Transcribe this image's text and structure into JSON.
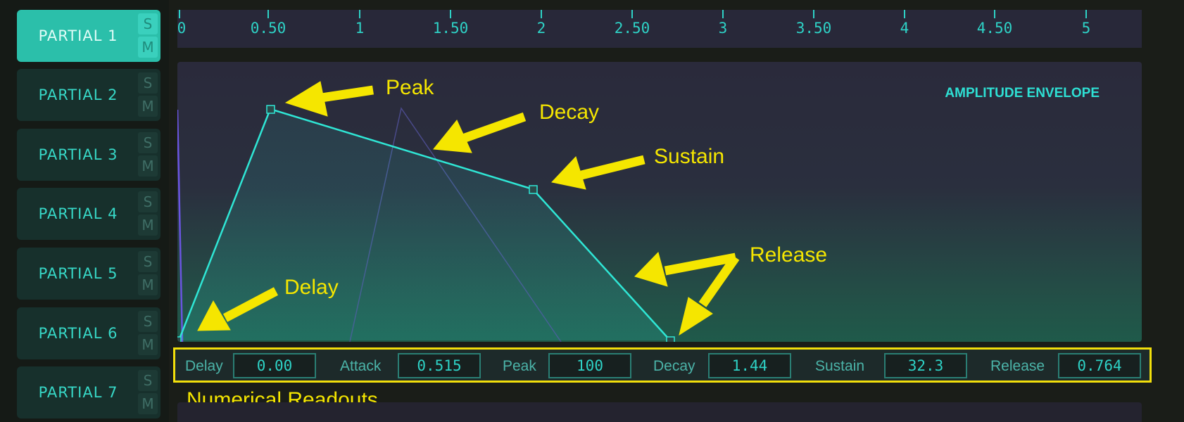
{
  "partials": [
    {
      "label": "PARTIAL 1",
      "solo": "S",
      "mute": "M",
      "active": true
    },
    {
      "label": "PARTIAL 2",
      "solo": "S",
      "mute": "M",
      "active": false
    },
    {
      "label": "PARTIAL 3",
      "solo": "S",
      "mute": "M",
      "active": false
    },
    {
      "label": "PARTIAL 4",
      "solo": "S",
      "mute": "M",
      "active": false
    },
    {
      "label": "PARTIAL 5",
      "solo": "S",
      "mute": "M",
      "active": false
    },
    {
      "label": "PARTIAL 6",
      "solo": "S",
      "mute": "M",
      "active": false
    },
    {
      "label": "PARTIAL 7",
      "solo": "S",
      "mute": "M",
      "active": false
    }
  ],
  "ruler": {
    "ticks": [
      "0",
      "0.50",
      "1",
      "1.50",
      "2",
      "2.50",
      "3",
      "3.50",
      "4",
      "4.50",
      "5"
    ]
  },
  "envelope": {
    "title": "AMPLITUDE ENVELOPE",
    "annotations": {
      "peak": "Peak",
      "decay": "Decay",
      "sustain": "Sustain",
      "release": "Release",
      "delay": "Delay"
    }
  },
  "readouts": {
    "delay_label": "Delay",
    "delay_value": "0.00",
    "attack_label": "Attack",
    "attack_value": "0.515",
    "peak_label": "Peak",
    "peak_value": "100",
    "decay_label": "Decay",
    "decay_value": "1.44",
    "sustain_label": "Sustain",
    "sustain_value": "32.3",
    "release_label": "Release",
    "release_value": "0.764"
  },
  "caption": "Numerical Readouts",
  "colors": {
    "accent": "#2ed2c6",
    "annotation": "#f5e600",
    "active_partial": "#2bbfaa"
  }
}
